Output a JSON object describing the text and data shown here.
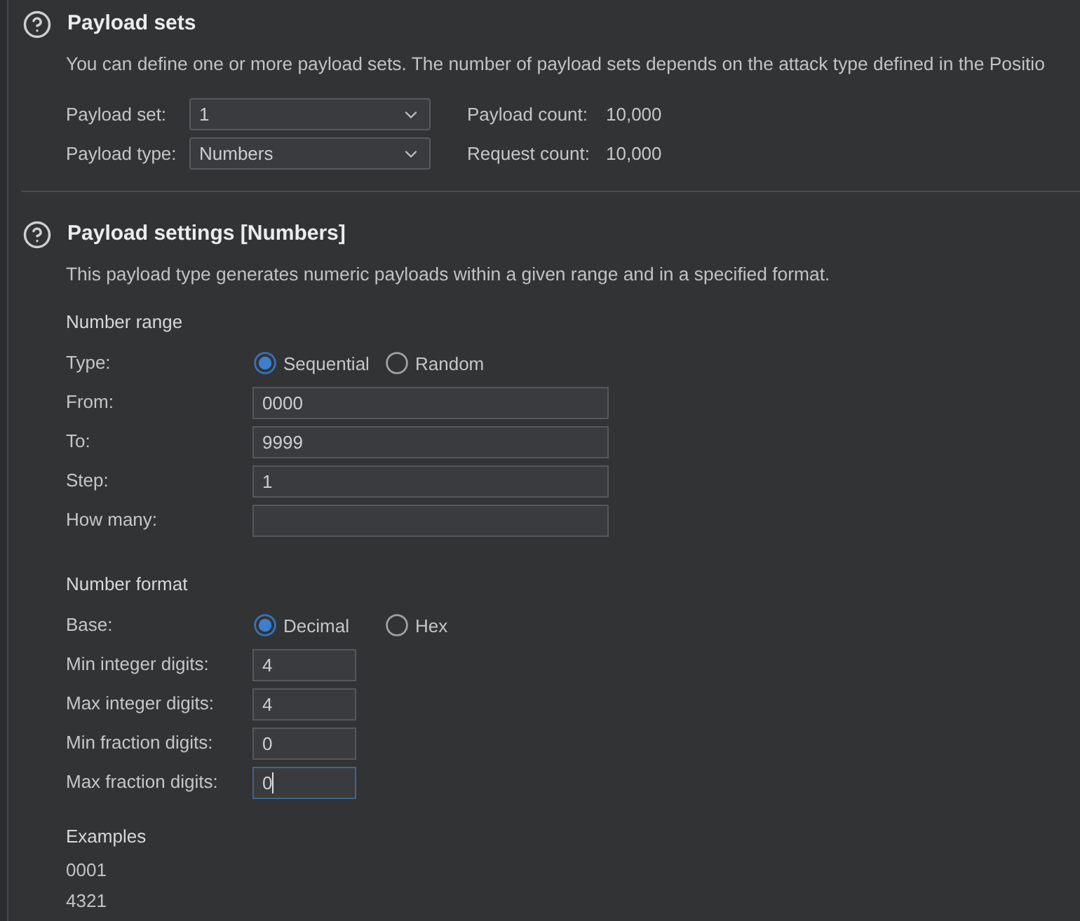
{
  "payload_sets": {
    "title": "Payload sets",
    "description": "You can define one or more payload sets. The number of payload sets depends on the attack type defined in the Positio",
    "selects": [
      {
        "label": "Payload set:",
        "value": "1"
      },
      {
        "label": "Payload type:",
        "value": "Numbers"
      }
    ],
    "counts": [
      {
        "label": "Payload count:",
        "value": "10,000"
      },
      {
        "label": "Request count:",
        "value": "10,000"
      }
    ]
  },
  "payload_settings": {
    "title": "Payload settings [Numbers]",
    "description": "This payload type generates numeric payloads within a given range and in a specified format.",
    "number_range": {
      "title": "Number range",
      "rows": [
        {
          "kind": "radio",
          "label": "Type:",
          "options": [
            {
              "label": "Sequential",
              "selected": true
            },
            {
              "label": "Random",
              "selected": false
            }
          ]
        },
        {
          "kind": "text",
          "label": "From:",
          "value": "0000",
          "focused": false
        },
        {
          "kind": "text",
          "label": "To:",
          "value": "9999",
          "focused": false
        },
        {
          "kind": "text",
          "label": "Step:",
          "value": "1",
          "focused": false
        },
        {
          "kind": "text",
          "label": "How many:",
          "focused": false
        }
      ]
    },
    "number_format": {
      "title": "Number format",
      "rows": [
        {
          "kind": "radio",
          "label": "Base:",
          "options": [
            {
              "label": "Decimal",
              "selected": true
            },
            {
              "label": "Hex",
              "selected": false
            }
          ]
        },
        {
          "kind": "text",
          "label": "Min integer digits:",
          "value": "4",
          "focused": false
        },
        {
          "kind": "text",
          "label": "Max integer digits:",
          "value": "4",
          "focused": false
        },
        {
          "kind": "text",
          "label": "Min fraction digits:",
          "value": "0",
          "focused": false
        },
        {
          "kind": "text",
          "label": "Max fraction digits:",
          "value": "0",
          "focused": true
        }
      ]
    },
    "examples": {
      "title": "Examples",
      "items": [
        "0001",
        "4321"
      ]
    }
  }
}
